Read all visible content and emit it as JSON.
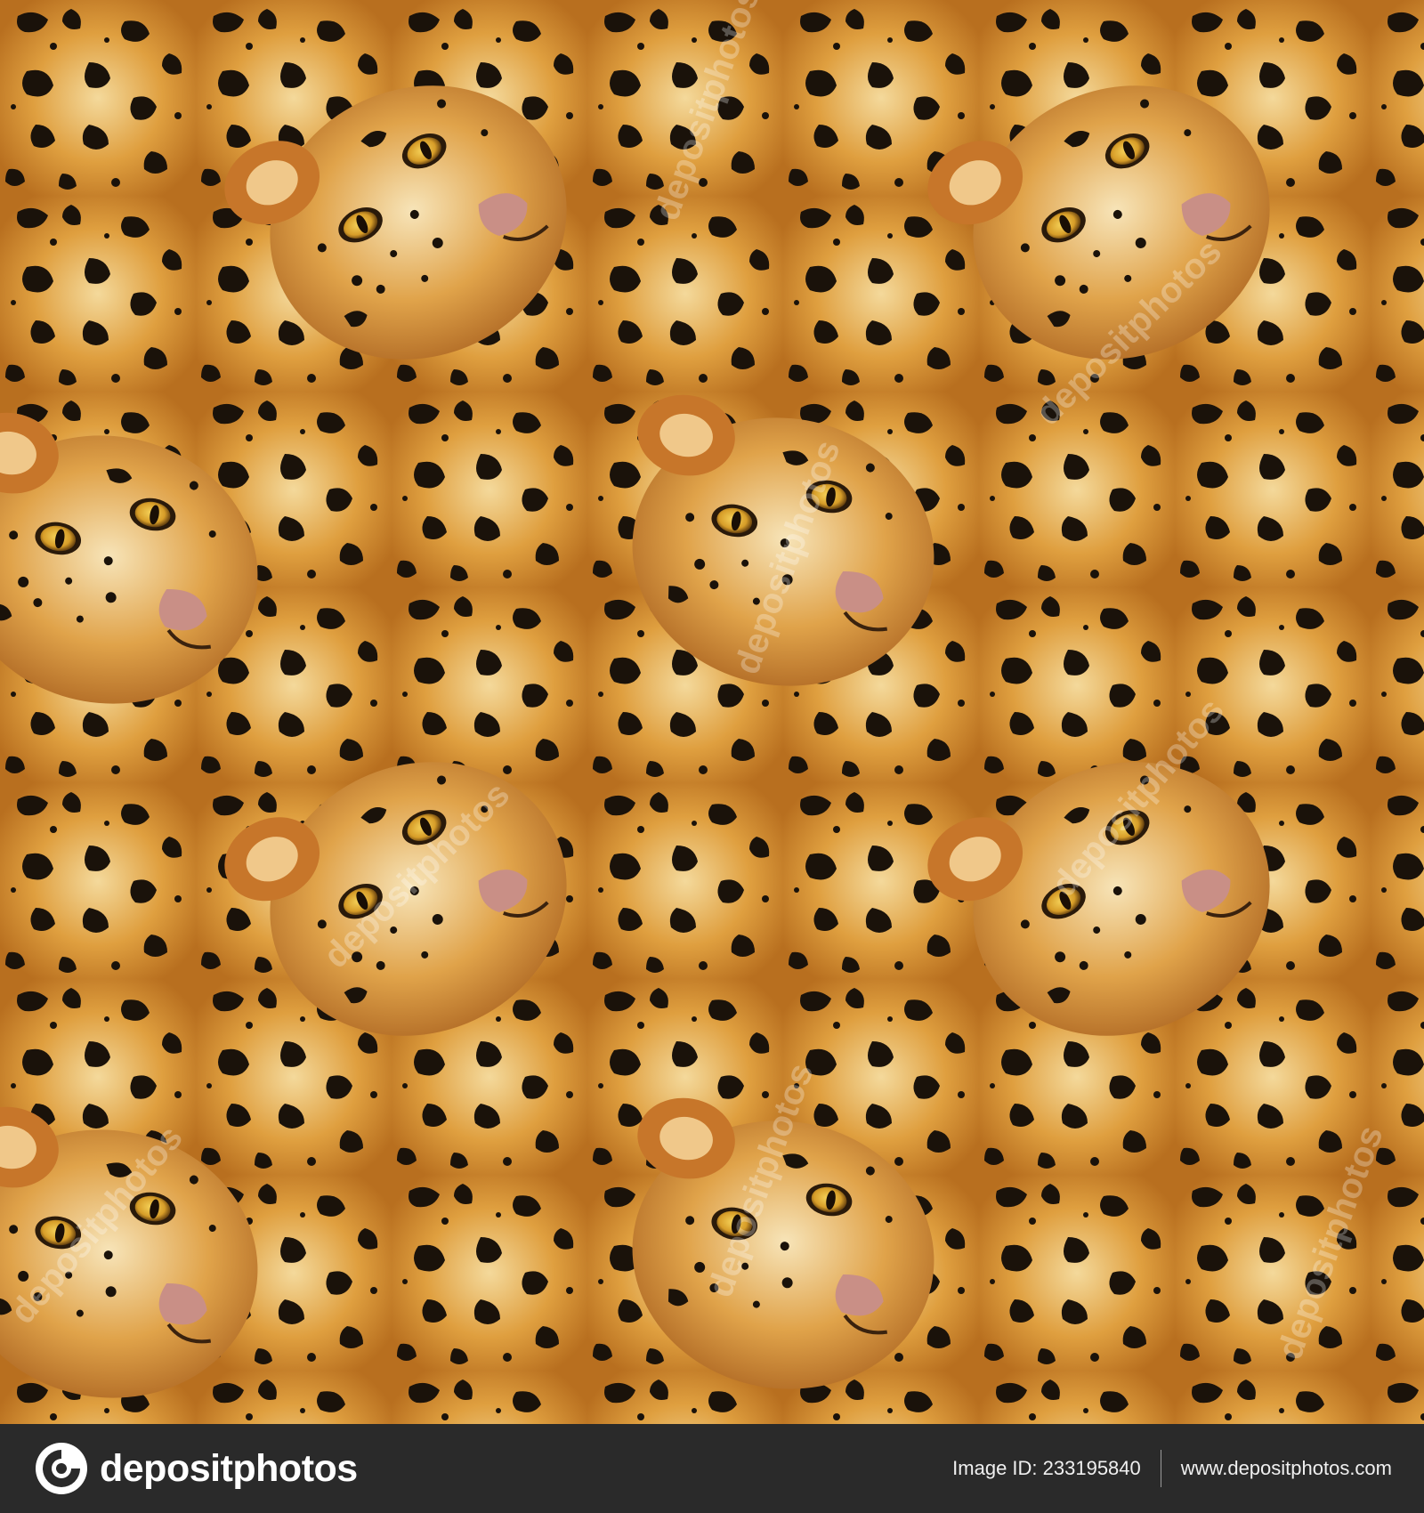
{
  "artwork": {
    "subject": "seamless leopard face and spotted fur pattern",
    "watermark_text": "depositphotos",
    "colors": {
      "base": "#d89a3c",
      "light": "#f3d79a",
      "dark": "#1a120a",
      "eye": "#e2b53b",
      "nose": "#c98f86"
    }
  },
  "footer": {
    "brand_name": "depositphotos",
    "image_id_label": "Image ID: 233195840",
    "site_url": "www.depositphotos.com",
    "background": "#2a2a2a"
  }
}
